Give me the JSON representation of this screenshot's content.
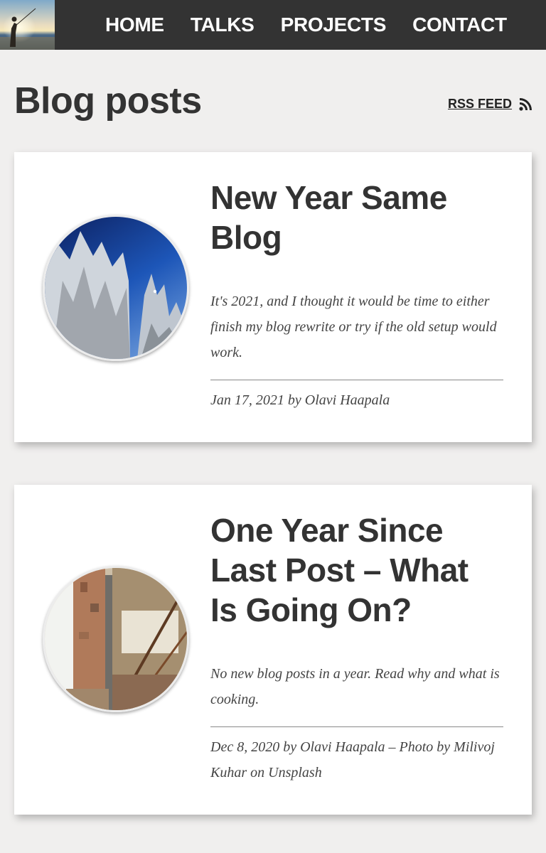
{
  "nav": {
    "items": [
      "HOME",
      "TALKS",
      "PROJECTS",
      "CONTACT"
    ]
  },
  "page": {
    "title": "Blog posts",
    "rss_label": "RSS FEED"
  },
  "posts": [
    {
      "title": "New Year Same Blog",
      "excerpt": "It's 2021, and I thought it would be time to either finish my blog rewrite or try if the old setup would work.",
      "meta": "Jan 17, 2021 by Olavi Haapala"
    },
    {
      "title": "One Year Since Last Post – What Is Going On?",
      "excerpt": "No new blog posts in a year. Read why and what is cooking.",
      "meta": "Dec 8, 2020 by Olavi Haapala – Photo by Milivoj Kuhar on Unsplash"
    }
  ],
  "colors": {
    "header_bg": "#333333",
    "page_bg": "#f0efee",
    "card_bg": "#ffffff",
    "text": "#333333"
  },
  "icons": [
    "site-logo",
    "rss-icon"
  ]
}
